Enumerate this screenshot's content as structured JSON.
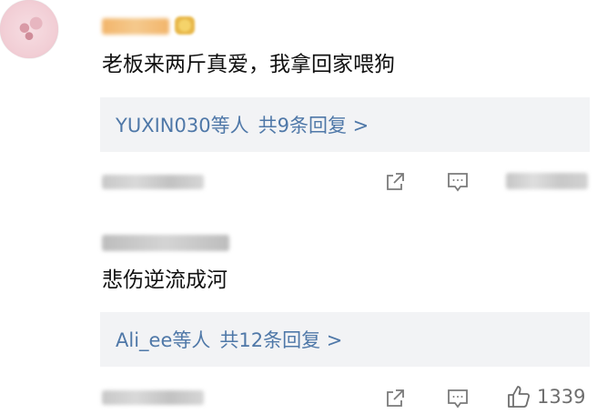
{
  "comments": [
    {
      "text": "老板来两斤真爱，我拿回家喂狗",
      "reply_users": "YUXIN030等人",
      "reply_count": "共9条回复 >"
    },
    {
      "text": "悲伤逆流成河",
      "reply_users": "Ali_ee等人",
      "reply_count": "共12条回复 >",
      "like_count": "1339"
    }
  ],
  "icons": {
    "share": "share-icon",
    "comment": "comment-icon",
    "like": "thumbs-up-icon"
  },
  "colors": {
    "link": "#4f78a8",
    "reply_bg": "#f2f3f5",
    "icon": "#7a7a7a"
  }
}
